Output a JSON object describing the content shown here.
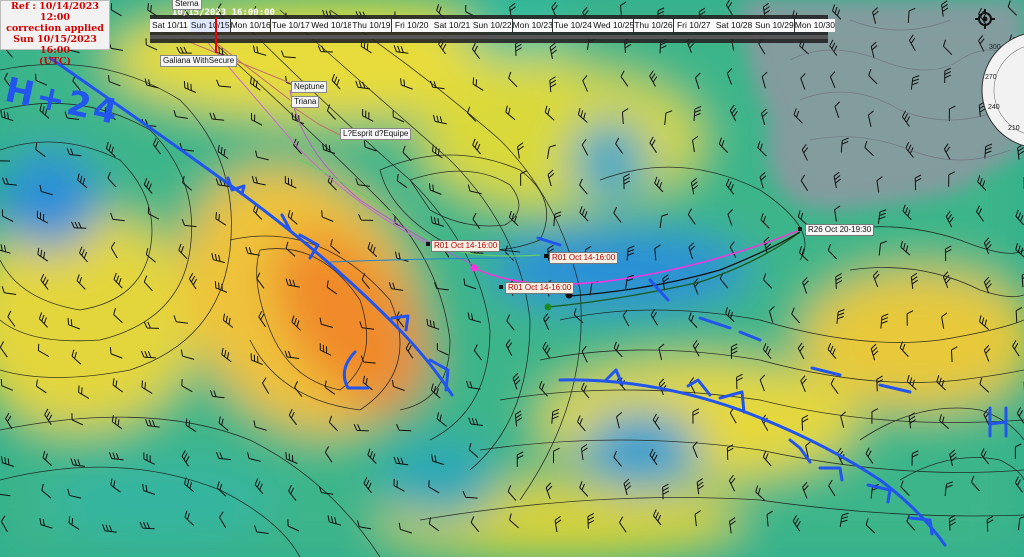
{
  "ref": {
    "line1": "Ref : 10/14/2023 12:00",
    "line2": "correction applied",
    "line3": "Sun 10/15/2023 16:00",
    "line4": "(UTC)"
  },
  "timeline": {
    "current": "10/15/2023 16:00:00",
    "days": [
      "Sat 10/11",
      "Sun 10/15",
      "Mon 10/16",
      "Tue 10/17",
      "Wed 10/18",
      "Thu 10/19",
      "Fri 10/20",
      "Sat 10/21",
      "Sun 10/22",
      "Mon 10/23",
      "Tue 10/24",
      "Wed 10/25",
      "Thu 10/26",
      "Fri 10/27",
      "Sat 10/28",
      "Sun 10/29",
      "Mon 10/30"
    ],
    "active_index": 1
  },
  "boats": {
    "sterna": "Sterna",
    "galiana": "Galiana WithSecure",
    "neptune": "Neptune",
    "triana": "Triana",
    "esprit": "L?Esprit d?Equipe"
  },
  "routes": {
    "r01_a": "R01 Oct 14-16:00",
    "r01_b": "R01 Oct 14-16:00",
    "r01_c": "R01 Oct 14-16:00",
    "r26": "R26 Oct 20-19:30"
  },
  "annotations": {
    "high_label": "H+24",
    "low_label": "L",
    "high_east": "H"
  },
  "compass": {
    "ticks": [
      "300",
      "270",
      "240",
      "210"
    ]
  },
  "colors": {
    "ocean_green": "#2fae8e",
    "wind_yellow": "#e7dc3a",
    "wind_orange": "#f08a2c",
    "calm_blue": "#2a8fd8",
    "land": "#8a9aa0",
    "front_blue": "#2255ee",
    "route_magenta": "#ff30e0",
    "route_green": "#1a9a3a"
  },
  "icons": {
    "target": "crosshair-target-icon"
  }
}
